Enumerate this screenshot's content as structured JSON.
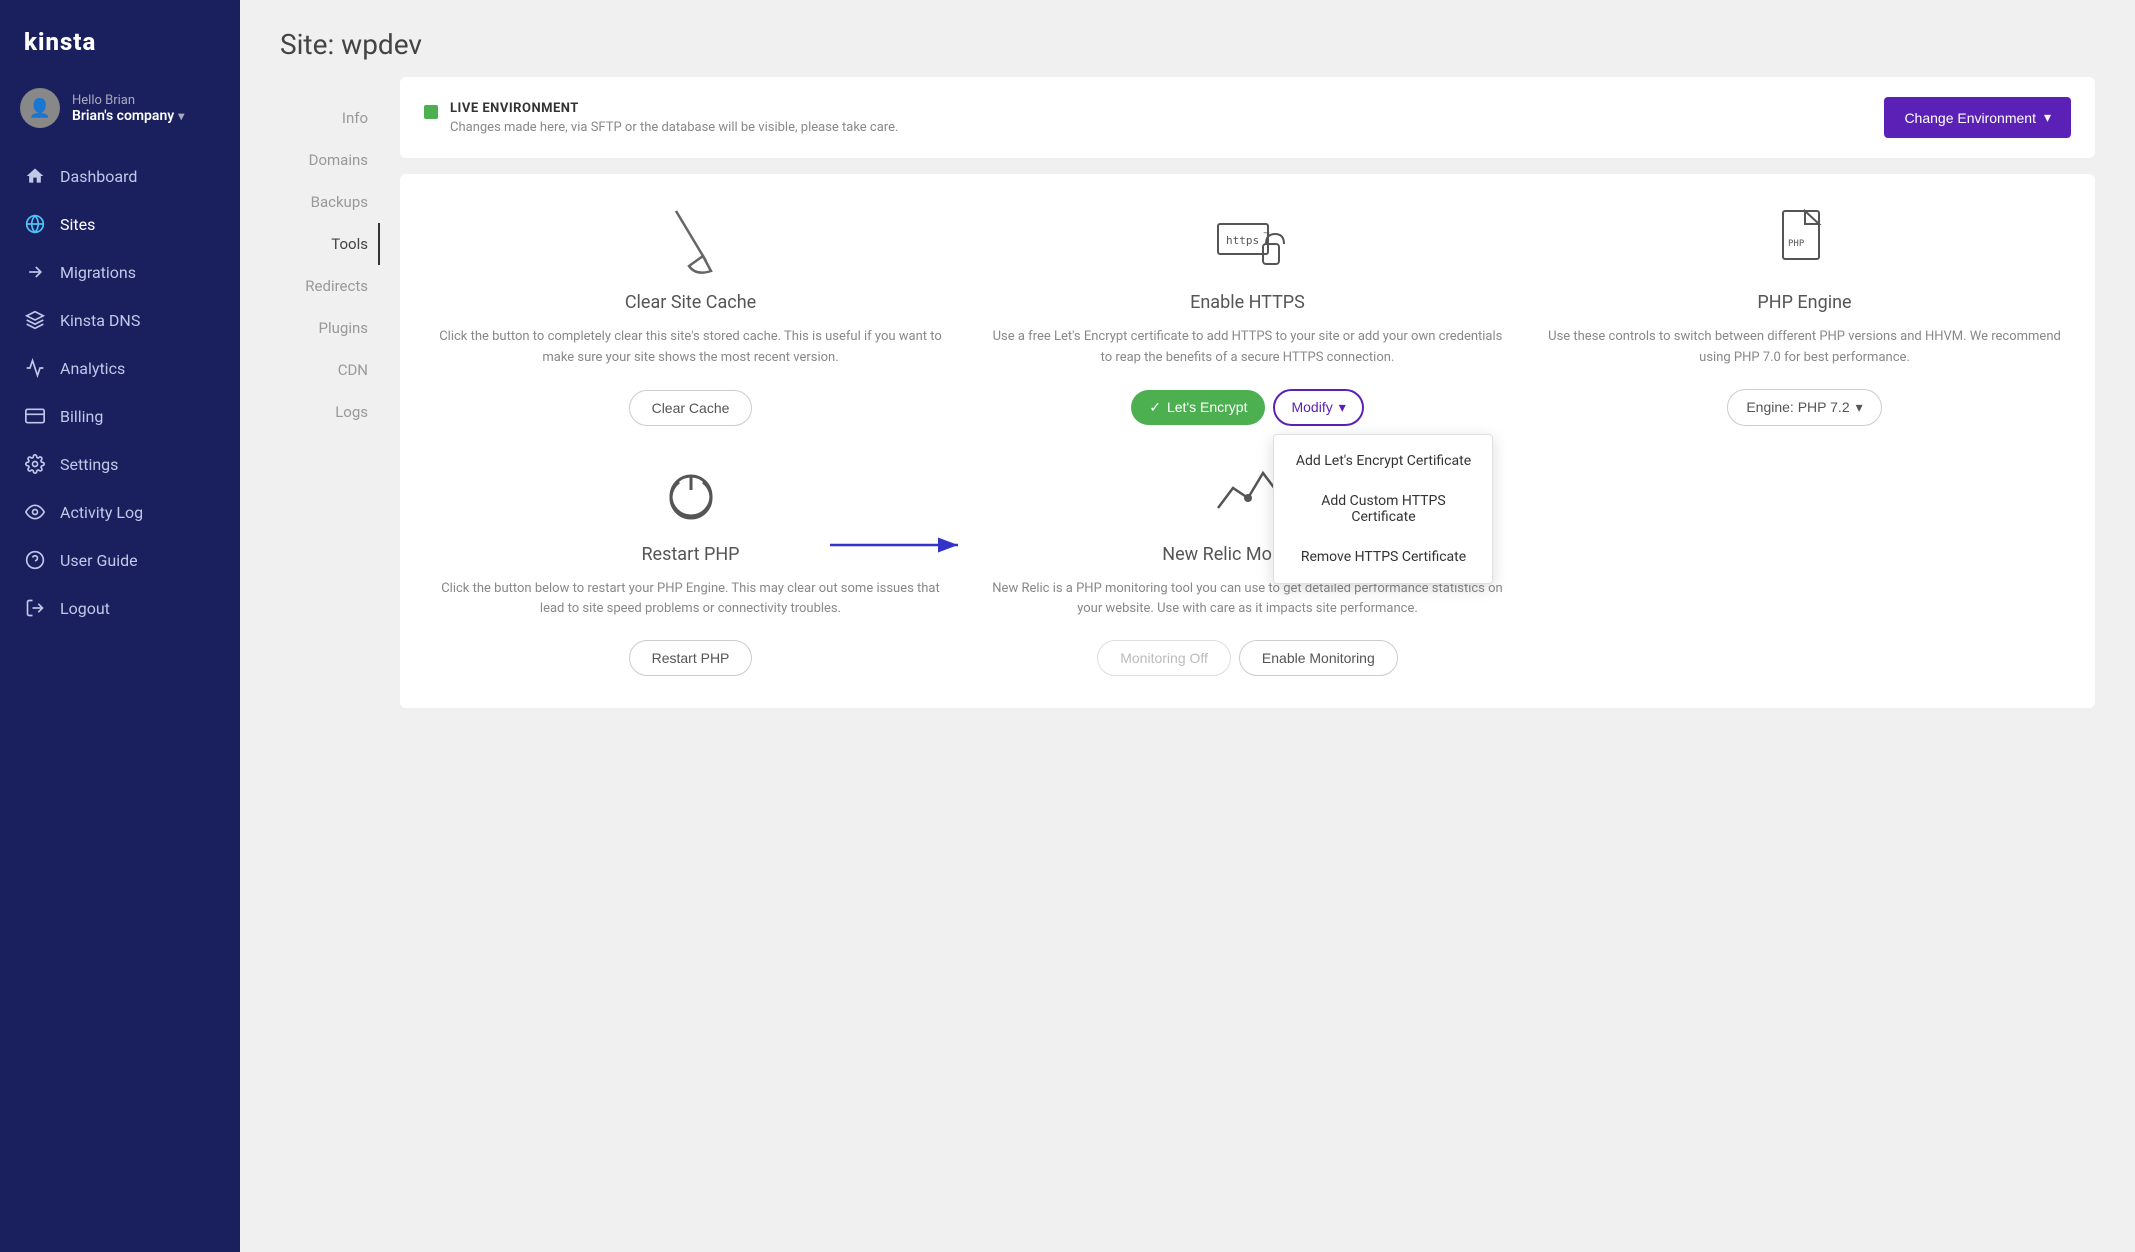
{
  "brand": "kinsta",
  "sidebar": {
    "user": {
      "hello": "Hello Brian",
      "company": "Brian's company"
    },
    "items": [
      {
        "id": "dashboard",
        "label": "Dashboard",
        "icon": "home"
      },
      {
        "id": "sites",
        "label": "Sites",
        "icon": "globe",
        "active": true
      },
      {
        "id": "migrations",
        "label": "Migrations",
        "icon": "arrow-right"
      },
      {
        "id": "kinsta-dns",
        "label": "Kinsta DNS",
        "icon": "dns"
      },
      {
        "id": "analytics",
        "label": "Analytics",
        "icon": "chart"
      },
      {
        "id": "billing",
        "label": "Billing",
        "icon": "card"
      },
      {
        "id": "settings",
        "label": "Settings",
        "icon": "gear"
      },
      {
        "id": "activity-log",
        "label": "Activity Log",
        "icon": "eye"
      },
      {
        "id": "user-guide",
        "label": "User Guide",
        "icon": "help"
      },
      {
        "id": "logout",
        "label": "Logout",
        "icon": "logout"
      }
    ]
  },
  "page": {
    "title": "Site: wpdev"
  },
  "env_banner": {
    "label": "LIVE ENVIRONMENT",
    "description": "Changes made here, via SFTP or the database will be visible, please take care.",
    "change_btn": "Change Environment"
  },
  "sub_nav": {
    "items": [
      {
        "id": "info",
        "label": "Info"
      },
      {
        "id": "domains",
        "label": "Domains"
      },
      {
        "id": "backups",
        "label": "Backups"
      },
      {
        "id": "tools",
        "label": "Tools",
        "active": true
      },
      {
        "id": "redirects",
        "label": "Redirects"
      },
      {
        "id": "plugins",
        "label": "Plugins"
      },
      {
        "id": "cdn",
        "label": "CDN"
      },
      {
        "id": "logs",
        "label": "Logs"
      }
    ]
  },
  "tools": {
    "clear_cache": {
      "title": "Clear Site Cache",
      "description": "Click the button to completely clear this site's stored cache. This is useful if you want to make sure your site shows the most recent version.",
      "btn_label": "Clear Cache"
    },
    "enable_https": {
      "title": "Enable HTTPS",
      "description": "Use a free Let's Encrypt certificate to add HTTPS to your site or add your own credentials to reap the benefits of a secure HTTPS connection.",
      "btn_letsencrypt": "Let's Encrypt",
      "btn_modify": "Modify",
      "dropdown_items": [
        "Add Let's Encrypt Certificate",
        "Add Custom HTTPS Certificate",
        "Remove HTTPS Certificate"
      ]
    },
    "php_engine": {
      "title": "PHP Engine",
      "description": "Use these controls to switch between different PHP versions and HHVM. We recommend using PHP 7.0 for best performance.",
      "btn_label": "Engine: PHP 7.2"
    },
    "restart_php": {
      "title": "Restart PHP",
      "description": "Click the button below to restart your PHP Engine. This may clear out some issues that lead to site speed problems or connectivity troubles.",
      "btn_label": "Restart PHP"
    },
    "new_relic": {
      "title": "New Relic Monitoring",
      "description": "New Relic is a PHP monitoring tool you can use to get detailed performance statistics on your website. Use with care as it impacts site performance.",
      "btn_monitoring_off": "Monitoring Off",
      "btn_enable": "Enable Monitoring"
    }
  }
}
